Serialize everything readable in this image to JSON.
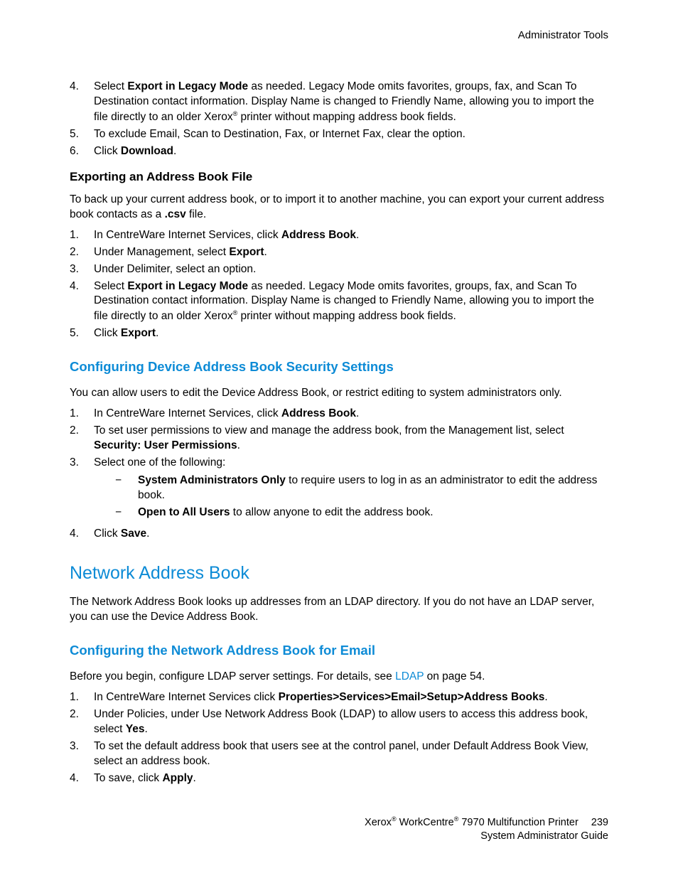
{
  "header": {
    "section": "Administrator Tools"
  },
  "top_list": {
    "i4_pre": "Select ",
    "i4_bold": "Export in Legacy Mode",
    "i4_post1": " as needed. Legacy Mode omits favorites, groups, fax, and Scan To Destination contact information. Display Name is changed to Friendly Name, allowing you to import the file directly to an older Xerox",
    "i4_post2": " printer without mapping address book fields.",
    "i5": "To exclude Email, Scan to Destination, Fax, or Internet Fax, clear the option.",
    "i6_pre": "Click ",
    "i6_bold": "Download",
    "i6_post": "."
  },
  "export_section": {
    "title": "Exporting an Address Book File",
    "intro_pre": "To back up your current address book, or to import it to another machine, you can export your current address book contacts as a ",
    "intro_bold": ".csv",
    "intro_post": " file.",
    "i1_pre": "In CentreWare Internet Services, click ",
    "i1_bold": "Address Book",
    "i1_post": ".",
    "i2_pre": "Under Management, select ",
    "i2_bold": "Export",
    "i2_post": ".",
    "i3": "Under Delimiter, select an option.",
    "i4_pre": "Select ",
    "i4_bold": "Export in Legacy Mode",
    "i4_post1": " as needed. Legacy Mode omits favorites, groups, fax, and Scan To Destination contact information. Display Name is changed to Friendly Name, allowing you to import the file directly to an older Xerox",
    "i4_post2": " printer without mapping address book fields.",
    "i5_pre": "Click ",
    "i5_bold": "Export",
    "i5_post": "."
  },
  "security_section": {
    "title": "Configuring Device Address Book Security Settings",
    "intro": "You can allow users to edit the Device Address Book, or restrict editing to system administrators only.",
    "i1_pre": "In CentreWare Internet Services, click ",
    "i1_bold": "Address Book",
    "i1_post": ".",
    "i2_pre": "To set user permissions to view and manage the address book, from the Management list, select ",
    "i2_bold": "Security: User Permissions",
    "i2_post": ".",
    "i3": "Select one of the following:",
    "sub_a_bold": "System Administrators Only",
    "sub_a_post": " to require users to log in as an administrator to edit the address book.",
    "sub_b_bold": "Open to All Users",
    "sub_b_post": " to allow anyone to edit the address book.",
    "i4_pre": "Click ",
    "i4_bold": "Save",
    "i4_post": "."
  },
  "network_section": {
    "title": "Network Address Book",
    "intro": "The Network Address Book looks up addresses from an LDAP directory. If you do not have an LDAP server, you can use the Device Address Book."
  },
  "email_section": {
    "title": "Configuring the Network Address Book for Email",
    "intro_pre": "Before you begin, configure LDAP server settings. For details, see ",
    "intro_link": "LDAP",
    "intro_post": " on page 54.",
    "i1_pre": "In CentreWare Internet Services click ",
    "i1_bold": "Properties>Services>Email>Setup>Address Books",
    "i1_post": ".",
    "i2_pre": "Under Policies, under Use Network Address Book (LDAP) to allow users to access this address book, select ",
    "i2_bold": "Yes",
    "i2_post": ".",
    "i3": "To set the default address book that users see at the control panel, under Default Address Book View, select an address book.",
    "i4_pre": "To save, click ",
    "i4_bold": "Apply",
    "i4_post": "."
  },
  "footer": {
    "line1a": "Xerox",
    "line1b": " WorkCentre",
    "line1c": " 7970 Multifunction Printer",
    "page": "239",
    "line2": "System Administrator Guide"
  }
}
